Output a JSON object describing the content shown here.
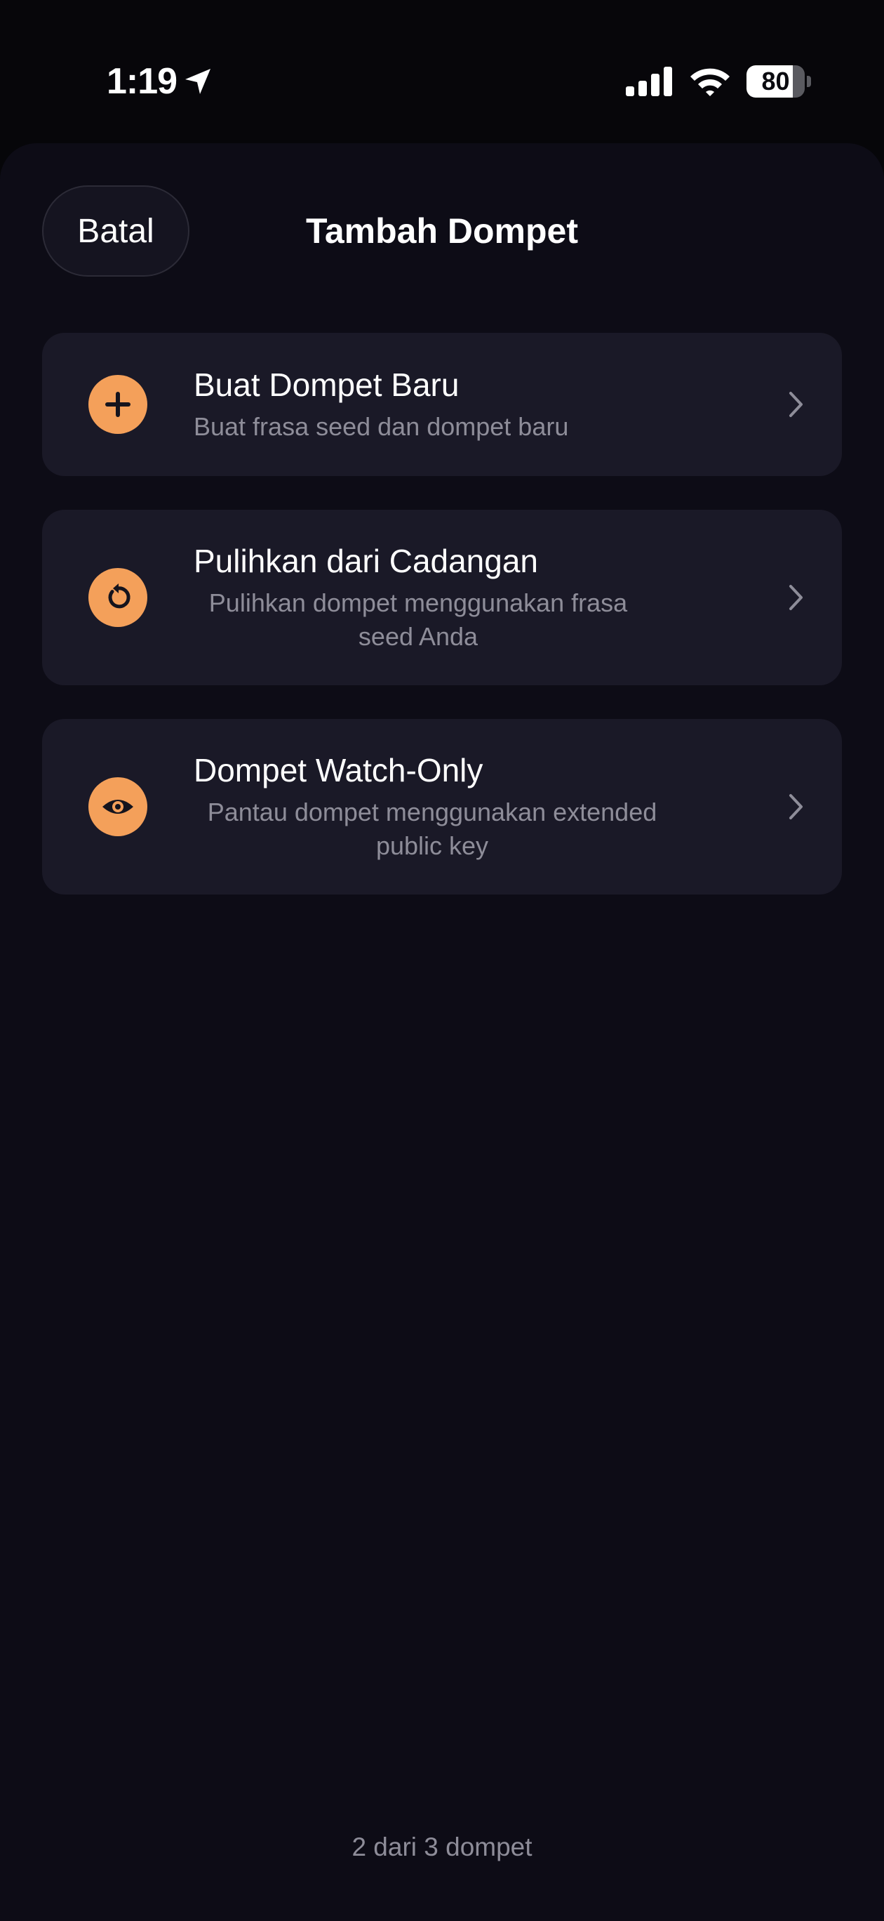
{
  "status_bar": {
    "time": "1:19",
    "location_icon": "location-arrow-icon",
    "signal_icon": "cellular-signal-icon",
    "wifi_icon": "wifi-icon",
    "battery_level": "80",
    "battery_fraction": 0.8
  },
  "header": {
    "cancel_label": "Batal",
    "title": "Tambah Dompet"
  },
  "options": [
    {
      "title": "Buat Dompet Baru",
      "description": "Buat frasa seed dan dompet baru",
      "icon": "plus-icon"
    },
    {
      "title": "Pulihkan dari Cadangan",
      "description": "Pulihkan dompet menggunakan frasa seed Anda",
      "icon": "restore-icon"
    },
    {
      "title": "Dompet Watch-Only",
      "description": "Pantau dompet menggunakan extended public key",
      "icon": "eye-icon"
    }
  ],
  "footer": {
    "wallet_count": "2 dari 3 dompet"
  },
  "colors": {
    "accent": "#f4a05a",
    "sheet_background": "#0d0c16",
    "card_background": "#1a1927",
    "secondary_text": "#8e8d99"
  }
}
